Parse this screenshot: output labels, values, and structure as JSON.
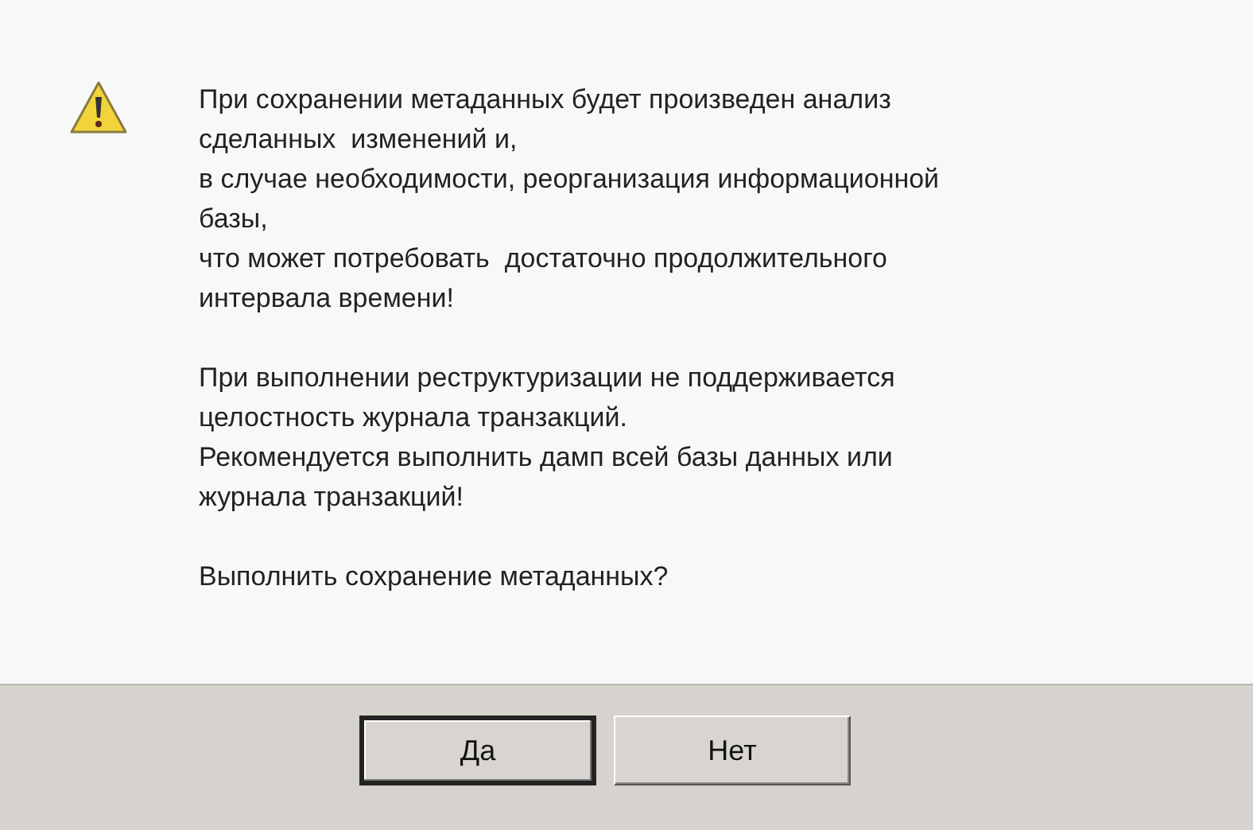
{
  "message": {
    "paragraphs": [
      {
        "lines": [
          "При сохранении метаданных будет произведен анализ",
          "сделанных  изменений и,",
          "в случае необходимости, реорганизация информационной",
          "базы,",
          "что может потребовать  достаточно продолжительного",
          "интервала времени!"
        ]
      },
      {
        "lines": [
          "При выполнении реструктуризации не поддерживается",
          "целостность журнала транзакций.",
          "Рекомендуется выполнить дамп всей базы данных или",
          "журнала транзакций!"
        ]
      },
      {
        "lines": [
          "Выполнить сохранение метаданных?"
        ]
      }
    ]
  },
  "buttons": [
    {
      "label": "Да",
      "default": true
    },
    {
      "label": "Нет",
      "default": false
    }
  ]
}
